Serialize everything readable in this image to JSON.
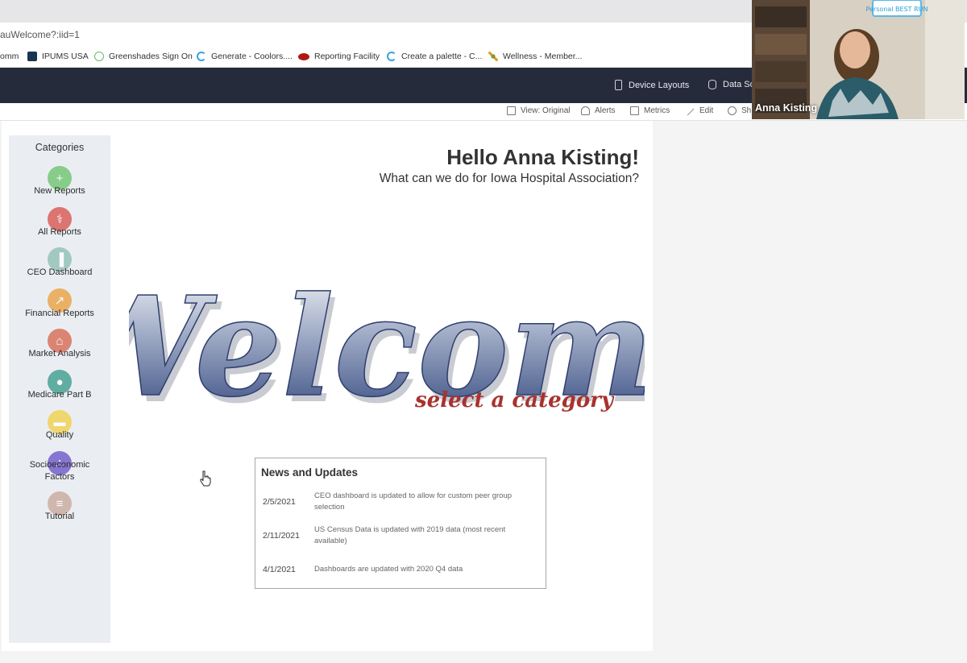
{
  "browser": {
    "url_fragment": "auWelcome?:iid=1"
  },
  "bookmarks": [
    {
      "label": "omm",
      "icon": "bookmark-icon",
      "color": ""
    },
    {
      "label": "IPUMS USA",
      "icon": "ipums-icon",
      "color": "#1a3550"
    },
    {
      "label": "Greenshades Sign On",
      "icon": "greenshades-icon",
      "color": "#6bb66b"
    },
    {
      "label": "Generate - Coolors....",
      "icon": "coolors-icon",
      "color": "#3aa0e0"
    },
    {
      "label": "Reporting Facility",
      "icon": "reporting-facility-icon",
      "color": "#b01818"
    },
    {
      "label": "Create a palette - C...",
      "icon": "coolors-icon",
      "color": "#3aa0e0"
    },
    {
      "label": "Wellness - Member...",
      "icon": "wellness-icon",
      "color": "#7a9a3a"
    }
  ],
  "header": {
    "device_layouts": "Device Layouts",
    "data_source": "Data So"
  },
  "toolbar": {
    "view": "View: Original",
    "alerts": "Alerts",
    "metrics": "Metrics",
    "edit": "Edit",
    "share": "Sh"
  },
  "sidebar": {
    "title": "Categories",
    "items": [
      {
        "label": "New Reports",
        "icon": "plus-icon",
        "color": "#6cc46c"
      },
      {
        "label": "All Reports",
        "icon": "stethoscope-icon",
        "color": "#d9534f"
      },
      {
        "label": "CEO Dashboard",
        "icon": "bar-chart-icon",
        "color": "#8fbfb3"
      },
      {
        "label": "Financial Reports",
        "icon": "line-chart-icon",
        "color": "#eaa040"
      },
      {
        "label": "Market Analysis",
        "icon": "hospital-icon",
        "color": "#d9674f"
      },
      {
        "label": "Medicare Part B",
        "icon": "doctor-icon",
        "color": "#3a9c8c"
      },
      {
        "label": "Quality",
        "icon": "ambulance-icon",
        "color": "#f2d04a"
      },
      {
        "label": "Socioeconomic Factors",
        "icon": "people-icon",
        "color": "#6a54c8"
      },
      {
        "label": "Tutorial",
        "icon": "books-icon",
        "color": "#c9a89a"
      }
    ]
  },
  "greeting": {
    "title": "Hello Anna Kisting!",
    "subtitle": "What can we do for Iowa Hospital Association?"
  },
  "welcome": {
    "headline": "Welcome",
    "tagline": "select a category",
    "headline_color": "#3a4f80",
    "tagline_color": "#a8322f"
  },
  "news": {
    "title": "News and Updates",
    "items": [
      {
        "date": "2/5/2021",
        "text": "CEO dashboard is updated to allow for custom peer group selection"
      },
      {
        "date": "2/11/2021",
        "text": "US Census Data is updated with 2019 data (most recent available)"
      },
      {
        "date": "4/1/2021",
        "text": "Dashboards are updated with 2020 Q4 data"
      }
    ]
  },
  "video": {
    "participant": "Anna Kisting",
    "poster_text": "Personal BEST RUN"
  }
}
